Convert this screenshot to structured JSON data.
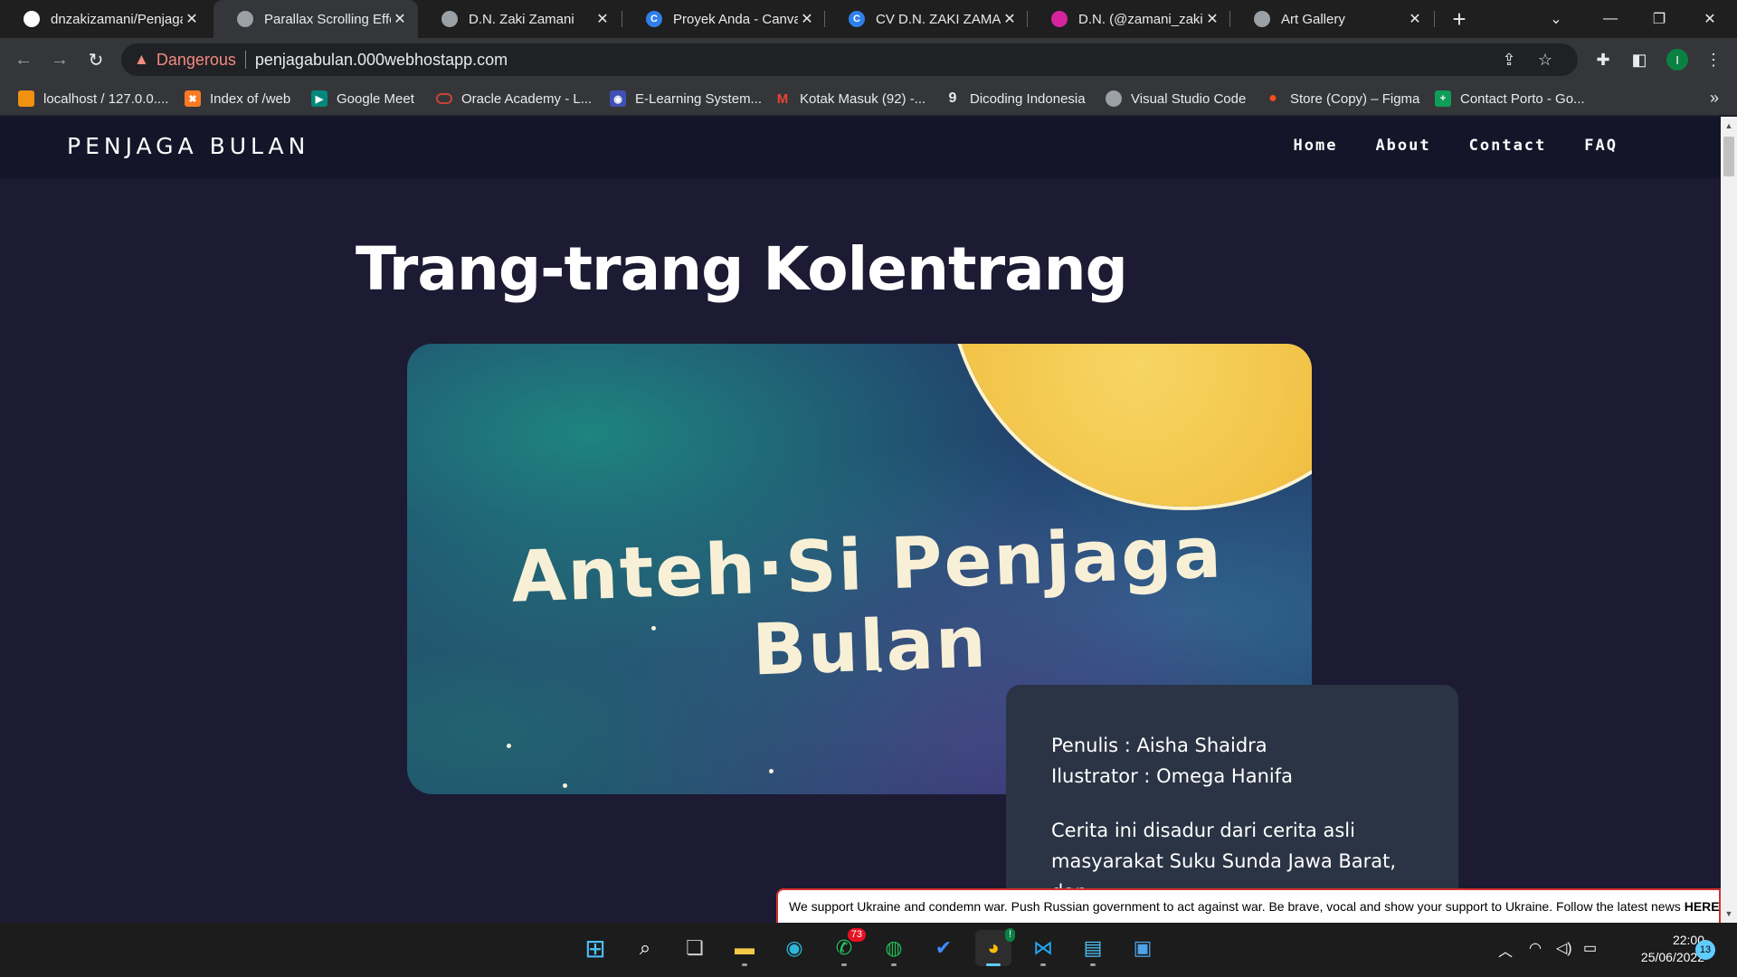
{
  "tabs": [
    {
      "title": "dnzakizamani/Penjaga",
      "icon": "github-icon",
      "color": "#ffffff",
      "glyph": ""
    },
    {
      "title": "Parallax Scrolling Effec",
      "icon": "globe-icon",
      "color": "#9aa0a6",
      "glyph": ""
    },
    {
      "title": "D.N. Zaki Zamani",
      "icon": "globe-icon",
      "color": "#9aa0a6",
      "glyph": ""
    },
    {
      "title": "Proyek Anda - Canva",
      "icon": "canva-icon",
      "color": "#2f80ed",
      "glyph": "C"
    },
    {
      "title": "CV D.N. ZAKI ZAMAN",
      "icon": "canva-icon",
      "color": "#2f80ed",
      "glyph": "C"
    },
    {
      "title": "D.N. (@zamani_zaki) •",
      "icon": "instagram-icon",
      "color": "#d6249f",
      "glyph": ""
    },
    {
      "title": "Art Gallery",
      "icon": "globe-icon",
      "color": "#9aa0a6",
      "glyph": ""
    }
  ],
  "address": {
    "security_label": "Dangerous",
    "url": "penjagabulan.000webhostapp.com",
    "profile_initial": "I"
  },
  "bookmarks": [
    {
      "label": "localhost / 127.0.0....",
      "icon": "phpmyadmin-icon",
      "color": "#f29111",
      "glyph": ""
    },
    {
      "label": "Index of /web",
      "icon": "xampp-icon",
      "color": "#fb7a24",
      "glyph": "✖"
    },
    {
      "label": "Google Meet",
      "icon": "google-meet-icon",
      "color": "#00897b",
      "glyph": "▶"
    },
    {
      "label": "Oracle Academy - L...",
      "icon": "oracle-icon",
      "color": "#c74634",
      "glyph": ""
    },
    {
      "label": "E-Learning System...",
      "icon": "elearning-icon",
      "color": "#3f51b5",
      "glyph": "◉"
    },
    {
      "label": "Kotak Masuk (92) -...",
      "icon": "gmail-icon",
      "color": "#ea4335",
      "glyph": "M"
    },
    {
      "label": "Dicoding Indonesia",
      "icon": "dicoding-icon",
      "color": "#2d3e50",
      "glyph": "9"
    },
    {
      "label": "Visual Studio Code",
      "icon": "globe-icon",
      "color": "#9aa0a6",
      "glyph": ""
    },
    {
      "label": "Store (Copy) – Figma",
      "icon": "figma-icon",
      "color": "#f24e1e",
      "glyph": "●"
    },
    {
      "label": "Contact Porto - Go...",
      "icon": "google-sheets-icon",
      "color": "#0f9d58",
      "glyph": "+"
    }
  ],
  "site": {
    "brand": "PENJAGA BULAN",
    "nav": [
      "Home",
      "About",
      "Contact",
      "FAQ"
    ],
    "headline": "Trang-trang Kolentrang",
    "cover_title": "Anteh·Si Penjaga Bulan",
    "writer": "Penulis : Aisha Shaidra",
    "illustrator": "Ilustrator : Omega Hanifa",
    "description": "Cerita ini disadur dari cerita asli masyarakat Suku Sunda Jawa Barat, dan"
  },
  "banner": {
    "text": "We support Ukraine and condemn war. Push Russian government to act against war. Be brave, vocal and show your support to Ukraine. Follow the latest news",
    "link": "HERE"
  },
  "taskbar": {
    "whatsapp_badge": "73",
    "chrome_badge": "!",
    "time": "22:00",
    "date": "25/06/2022",
    "notifications": "13"
  }
}
